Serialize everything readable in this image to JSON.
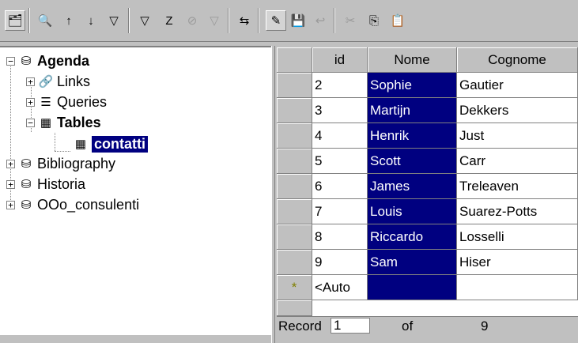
{
  "toolbar": {
    "buttons": [
      {
        "name": "explorer-toggle-icon",
        "glyph": "🗂"
      },
      {
        "name": "find-record-icon",
        "glyph": "🔍"
      },
      {
        "name": "sort-ascending-icon",
        "glyph": "↑"
      },
      {
        "name": "sort-descending-icon",
        "glyph": "↓"
      },
      {
        "name": "autofilter-icon",
        "glyph": "▽"
      },
      {
        "name": "standard-filter-icon",
        "glyph": "▽"
      },
      {
        "name": "sort-icon",
        "glyph": "Z"
      },
      {
        "name": "remove-filter-icon",
        "glyph": "⊘"
      },
      {
        "name": "apply-filter-icon",
        "glyph": "▽"
      },
      {
        "name": "data-to-text-icon",
        "glyph": "⇆"
      },
      {
        "name": "edit-data-icon",
        "glyph": "✎"
      },
      {
        "name": "save-record-icon",
        "glyph": "💾"
      },
      {
        "name": "undo-record-icon",
        "glyph": "↩"
      },
      {
        "name": "cut-icon",
        "glyph": "✂"
      },
      {
        "name": "copy-icon",
        "glyph": "⎘"
      },
      {
        "name": "paste-icon",
        "glyph": "📋"
      }
    ]
  },
  "tree": {
    "agenda": "Agenda",
    "links": "Links",
    "queries": "Queries",
    "tables": "Tables",
    "contatti": "contatti",
    "bibliography": "Bibliography",
    "historia": "Historia",
    "ooo": "OOo_consulenti"
  },
  "grid": {
    "columns": [
      "id",
      "Nome",
      "Cognome"
    ],
    "rows": [
      {
        "id": "2",
        "nome": "Sophie",
        "cognome": "Gautier"
      },
      {
        "id": "3",
        "nome": "Martijn",
        "cognome": "Dekkers"
      },
      {
        "id": "4",
        "nome": "Henrik",
        "cognome": "Just"
      },
      {
        "id": "5",
        "nome": "Scott",
        "cognome": "Carr"
      },
      {
        "id": "6",
        "nome": "James",
        "cognome": "Treleaven"
      },
      {
        "id": "7",
        "nome": "Louis",
        "cognome": "Suarez-Potts"
      },
      {
        "id": "8",
        "nome": "Riccardo",
        "cognome": "Losselli"
      },
      {
        "id": "9",
        "nome": "Sam",
        "cognome": "Hiser"
      }
    ],
    "new_row_marker": "*",
    "new_row_value": "<Auto"
  },
  "nav": {
    "record_label": "Record",
    "record_value": "1",
    "of_label": "of",
    "total": "9"
  },
  "colors": {
    "selection": "#000080",
    "face": "#c0c0c0"
  }
}
